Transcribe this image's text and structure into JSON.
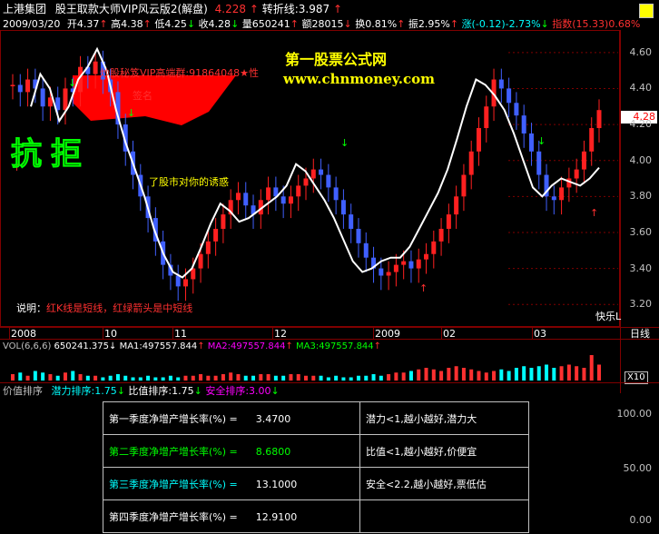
{
  "header": {
    "stock_name": "上港集团",
    "indicator_title": "股王取款大师VIP风云版2(解盘)",
    "price": "4.228",
    "price_arrow": "↑",
    "turn_line": "转折线:3.987",
    "turn_arrow": "↑",
    "date": "2009/03/20",
    "open": "开4.37",
    "high": "高4.38",
    "low": "低4.25",
    "close": "收4.28",
    "volume": "量650241",
    "amount": "额28015",
    "turnover": "换0.81%",
    "amplitude": "振2.95%",
    "change": "涨(-0.12)-2.73%",
    "index_value": "指数(15.33)0.68%"
  },
  "watermark": {
    "title": "第一股票公式网",
    "url": "www.chnmoney.com"
  },
  "main_chart": {
    "y_ticks": [
      "4.60",
      "4.40",
      "4.28",
      "4.20",
      "4.00",
      "3.80",
      "3.60",
      "3.40",
      "3.20"
    ],
    "current_price_label": "4.28",
    "annotation_red": "炒股秘笈VIP高端群:91864048★性",
    "annotation_red2": "签名",
    "annotation_resist": "抗拒",
    "annotation_temptation": "了股市对你的诱惑",
    "note_prefix": "说明：",
    "note_text": "红K线是短线，红绿箭头是中短线",
    "right_label": "快乐L"
  },
  "time_axis": {
    "labels": [
      "2008",
      "10",
      "11",
      "12",
      "2009",
      "02",
      "03"
    ],
    "period": "日线"
  },
  "volume_panel": {
    "title": "VOL(6,6,6)",
    "vol": "650241.375",
    "ma1": "MA1:497557.844",
    "ma2": "MA2:497557.844",
    "ma3": "MA3:497557.844",
    "scale": "X10",
    "arrow_down": "↓",
    "arrow_up": "↑"
  },
  "value_panel": {
    "title": "价值排序",
    "potential": "潜力排序:1.75",
    "ratio": "比值排序:1.75",
    "safety": "安全排序:3.00",
    "arrow": "↓",
    "y_ticks": [
      "100.00",
      "50.00",
      "0.00"
    ]
  },
  "fundamentals": [
    {
      "label": "第一季度净增产增长率(%) =",
      "value": "3.4700",
      "note": "潜力<1,越小越好,潜力大",
      "label_color": "#ffffff",
      "value_color": "#ffffff"
    },
    {
      "label": "第二季度净增产增长率(%) =",
      "value": "8.6800",
      "note": "比值<1,越小越好,价便宜",
      "label_color": "#00ff00",
      "value_color": "#00ff00"
    },
    {
      "label": "第三季度净增产增长率(%) =",
      "value": "13.1000",
      "note": "安全<2.2,越小越好,票低估",
      "label_color": "#00ffff",
      "value_color": "#ffffff"
    },
    {
      "label": "第四季度净增产增长率(%) =",
      "value": "12.9100",
      "note": "",
      "label_color": "#ffffff",
      "value_color": "#ffffff"
    }
  ],
  "chart_data": {
    "type": "candlestick",
    "title": "上港集团",
    "ylim": [
      3.1,
      4.7
    ],
    "y_ticks": [
      3.2,
      3.4,
      3.6,
      3.8,
      4.0,
      4.2,
      4.4,
      4.6
    ],
    "x_labels": [
      "2008",
      "10",
      "11",
      "12",
      "2009",
      "02",
      "03"
    ],
    "current_price": 4.28,
    "closes": [
      4.42,
      4.38,
      4.45,
      4.4,
      4.3,
      4.35,
      4.28,
      4.4,
      4.38,
      4.52,
      4.48,
      4.55,
      4.45,
      4.38,
      4.2,
      4.05,
      3.92,
      3.8,
      3.68,
      3.55,
      3.42,
      3.36,
      3.3,
      3.34,
      3.4,
      3.48,
      3.55,
      3.62,
      3.7,
      3.78,
      3.82,
      3.75,
      3.7,
      3.78,
      3.85,
      3.8,
      3.76,
      3.8,
      3.86,
      3.9,
      3.95,
      3.92,
      3.85,
      3.78,
      3.7,
      3.62,
      3.54,
      3.46,
      3.4,
      3.36,
      3.38,
      3.42,
      3.44,
      3.4,
      3.45,
      3.48,
      3.55,
      3.62,
      3.7,
      3.8,
      3.92,
      4.05,
      4.18,
      4.3,
      4.45,
      4.4,
      4.32,
      4.25,
      4.15,
      4.05,
      3.92,
      3.8,
      3.78,
      3.85,
      3.9,
      3.95,
      4.05,
      4.18,
      4.28
    ],
    "white_line": [
      4.3,
      4.48,
      4.4,
      4.22,
      4.3,
      4.45,
      4.52,
      4.62,
      4.5,
      4.28,
      4.1,
      3.95,
      3.8,
      3.62,
      3.48,
      3.38,
      3.35,
      3.4,
      3.52,
      3.65,
      3.76,
      3.72,
      3.66,
      3.68,
      3.72,
      3.76,
      3.8,
      3.86,
      3.98,
      3.94,
      3.86,
      3.78,
      3.68,
      3.56,
      3.44,
      3.38,
      3.4,
      3.44,
      3.46,
      3.46,
      3.52,
      3.62,
      3.72,
      3.82,
      3.95,
      4.12,
      4.3,
      4.45,
      4.42,
      4.36,
      4.28,
      4.15,
      4.0,
      3.85,
      3.8,
      3.86,
      3.9,
      3.88,
      3.86,
      3.9,
      3.96
    ],
    "volumes": [
      4,
      5,
      3,
      6,
      5,
      4,
      3,
      5,
      6,
      4,
      3,
      3,
      2,
      3,
      4,
      3,
      2,
      2,
      3,
      2,
      2,
      3,
      2,
      3,
      3,
      4,
      3,
      3,
      4,
      5,
      4,
      3,
      3,
      4,
      4,
      3,
      3,
      4,
      4,
      3,
      3,
      3,
      2,
      3,
      2,
      2,
      3,
      3,
      4,
      3,
      4,
      5,
      5,
      6,
      7,
      8,
      7,
      6,
      8,
      9,
      8,
      7,
      6,
      5,
      6,
      7,
      6,
      8,
      9,
      8,
      9,
      10,
      8,
      9,
      10,
      9,
      8,
      16,
      10
    ]
  }
}
